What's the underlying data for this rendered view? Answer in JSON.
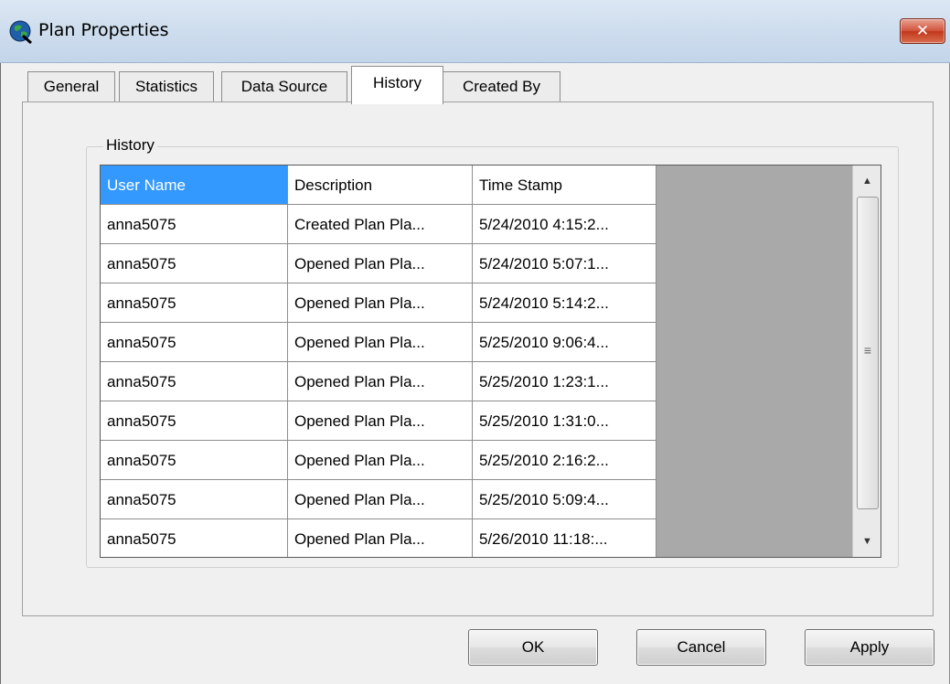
{
  "window": {
    "title": "Plan Properties",
    "close_glyph": "✕",
    "icon": "globe-icon"
  },
  "tabs": [
    {
      "label": "General"
    },
    {
      "label": "Statistics"
    },
    {
      "label": "Data Source"
    },
    {
      "label": "History",
      "active": true
    },
    {
      "label": "Created By"
    }
  ],
  "history": {
    "group_label": "History",
    "columns": [
      "User Name",
      "Description",
      "Time Stamp"
    ],
    "rows": [
      [
        "anna5075",
        "Created Plan Pla...",
        "5/24/2010 4:15:2..."
      ],
      [
        "anna5075",
        "Opened Plan Pla...",
        "5/24/2010 5:07:1..."
      ],
      [
        "anna5075",
        "Opened Plan Pla...",
        "5/24/2010 5:14:2..."
      ],
      [
        "anna5075",
        "Opened Plan Pla...",
        "5/25/2010 9:06:4..."
      ],
      [
        "anna5075",
        "Opened Plan Pla...",
        "5/25/2010 1:23:1..."
      ],
      [
        "anna5075",
        "Opened Plan Pla...",
        "5/25/2010 1:31:0..."
      ],
      [
        "anna5075",
        "Opened Plan Pla...",
        "5/25/2010 2:16:2..."
      ],
      [
        "anna5075",
        "Opened Plan Pla...",
        "5/25/2010 5:09:4..."
      ],
      [
        "anna5075",
        "Opened Plan Pla...",
        "5/26/2010 11:18:..."
      ]
    ],
    "scroll_up": "▲",
    "scroll_down": "▼",
    "scroll_grip": "≡"
  },
  "buttons": {
    "ok": "OK",
    "cancel": "Cancel",
    "apply": "Apply"
  },
  "colors": {
    "selection": "#3399ff",
    "grid_background": "#a9a9a9",
    "close_button": "#c2371c"
  }
}
